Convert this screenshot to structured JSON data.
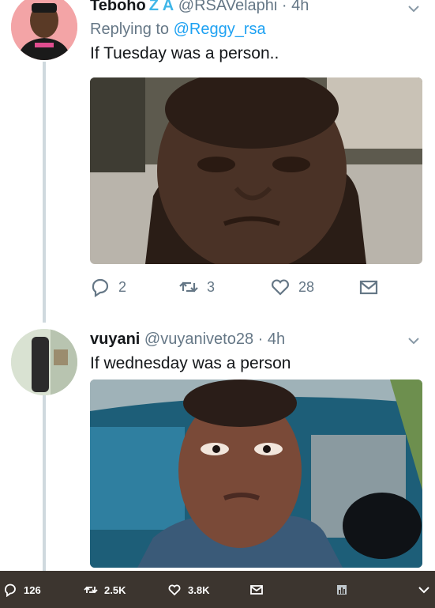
{
  "tweets": [
    {
      "display_name": "Teboho",
      "name_decoration": "Z A",
      "handle": "@RSAVelaphi",
      "separator": "·",
      "time": "4h",
      "reply_prefix": "Replying to",
      "reply_to": "@Reggy_rsa",
      "text": "If Tuesday was a person..",
      "replies": "2",
      "retweets": "3",
      "likes": "28"
    },
    {
      "display_name": "vuyani",
      "handle": "@vuyaniveto28",
      "separator": "·",
      "time": "4h",
      "text": "If wednesday was a person"
    }
  ],
  "bottom_bar": {
    "replies": "126",
    "retweets": "2.5K",
    "likes": "3.8K"
  },
  "colors": {
    "accent": "#1da1f2",
    "muted": "#657786",
    "bar": "#3c352f"
  }
}
